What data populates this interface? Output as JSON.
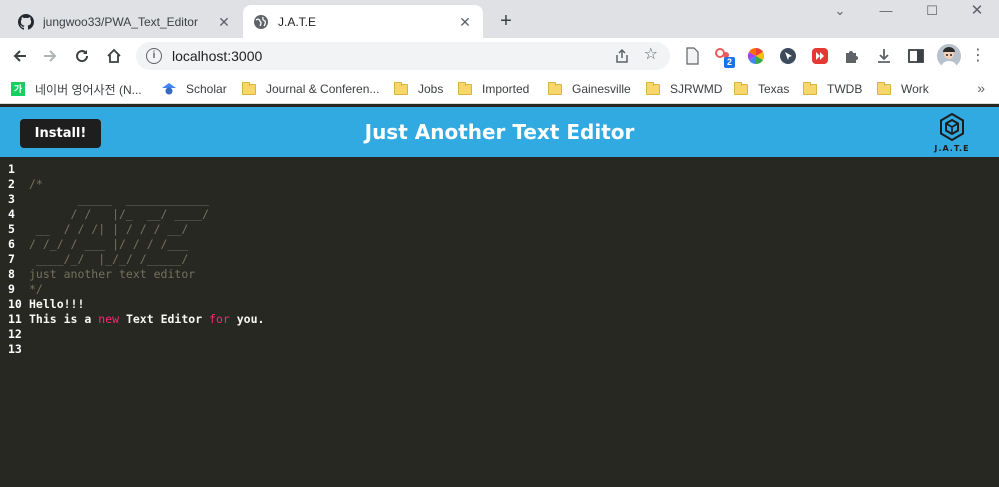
{
  "browser": {
    "tabs": [
      {
        "title": "jungwoo33/PWA_Text_Editor",
        "favicon": "github-icon",
        "active": false
      },
      {
        "title": "J.A.T.E",
        "favicon": "globe-icon",
        "active": true
      }
    ],
    "url": "localhost:3000",
    "extension_badge": "2",
    "bookmarks": [
      {
        "label": "네이버 영어사전 (N...",
        "icon": "naver-icon"
      },
      {
        "label": "Scholar",
        "icon": "scholar-icon"
      },
      {
        "label": "Journal & Conferen...",
        "icon": "folder-icon"
      },
      {
        "label": "Jobs",
        "icon": "folder-icon"
      },
      {
        "label": "Imported",
        "icon": "folder-icon"
      },
      {
        "label": "Gainesville",
        "icon": "folder-icon"
      },
      {
        "label": "SJRWMD",
        "icon": "folder-icon"
      },
      {
        "label": "Texas",
        "icon": "folder-icon"
      },
      {
        "label": "TWDB",
        "icon": "folder-icon"
      },
      {
        "label": "Work",
        "icon": "folder-icon"
      }
    ]
  },
  "app": {
    "install_label": "Install!",
    "title": "Just Another Text Editor",
    "logo_text": "J.A.T.E",
    "colors": {
      "header": "#31a9e1",
      "editor_bg": "#272822",
      "keyword": "#f92672",
      "comment": "#75715e"
    }
  },
  "editor": {
    "lines": [
      {
        "n": "1",
        "parts": []
      },
      {
        "n": "2",
        "parts": [
          {
            "t": "/*",
            "c": "cm"
          }
        ]
      },
      {
        "n": "3",
        "parts": [
          {
            "t": "       _____  ____________",
            "c": "cm"
          }
        ]
      },
      {
        "n": "4",
        "parts": [
          {
            "t": "      / /   |/_  __/ ____/",
            "c": "cm"
          }
        ]
      },
      {
        "n": "5",
        "parts": [
          {
            "t": " __  / / /| | / / / __/",
            "c": "cm"
          }
        ]
      },
      {
        "n": "6",
        "parts": [
          {
            "t": "/ /_/ / ___ |/ / / /___",
            "c": "cm"
          }
        ]
      },
      {
        "n": "7",
        "parts": [
          {
            "t": " ____/_/  |_/_/ /_____/",
            "c": "cm"
          }
        ]
      },
      {
        "n": "8",
        "parts": [
          {
            "t": "just another text editor",
            "c": "cm"
          }
        ]
      },
      {
        "n": "9",
        "parts": [
          {
            "t": "*/",
            "c": "cm"
          }
        ]
      },
      {
        "n": "10",
        "parts": [
          {
            "t": "Hello!!!",
            "c": "plain"
          }
        ]
      },
      {
        "n": "11",
        "parts": [
          {
            "t": "This is a ",
            "c": "plain"
          },
          {
            "t": "new",
            "c": "kw"
          },
          {
            "t": " Text Editor ",
            "c": "plain"
          },
          {
            "t": "for",
            "c": "kw"
          },
          {
            "t": " you.",
            "c": "plain"
          }
        ]
      },
      {
        "n": "12",
        "parts": []
      },
      {
        "n": "13",
        "parts": []
      }
    ]
  }
}
